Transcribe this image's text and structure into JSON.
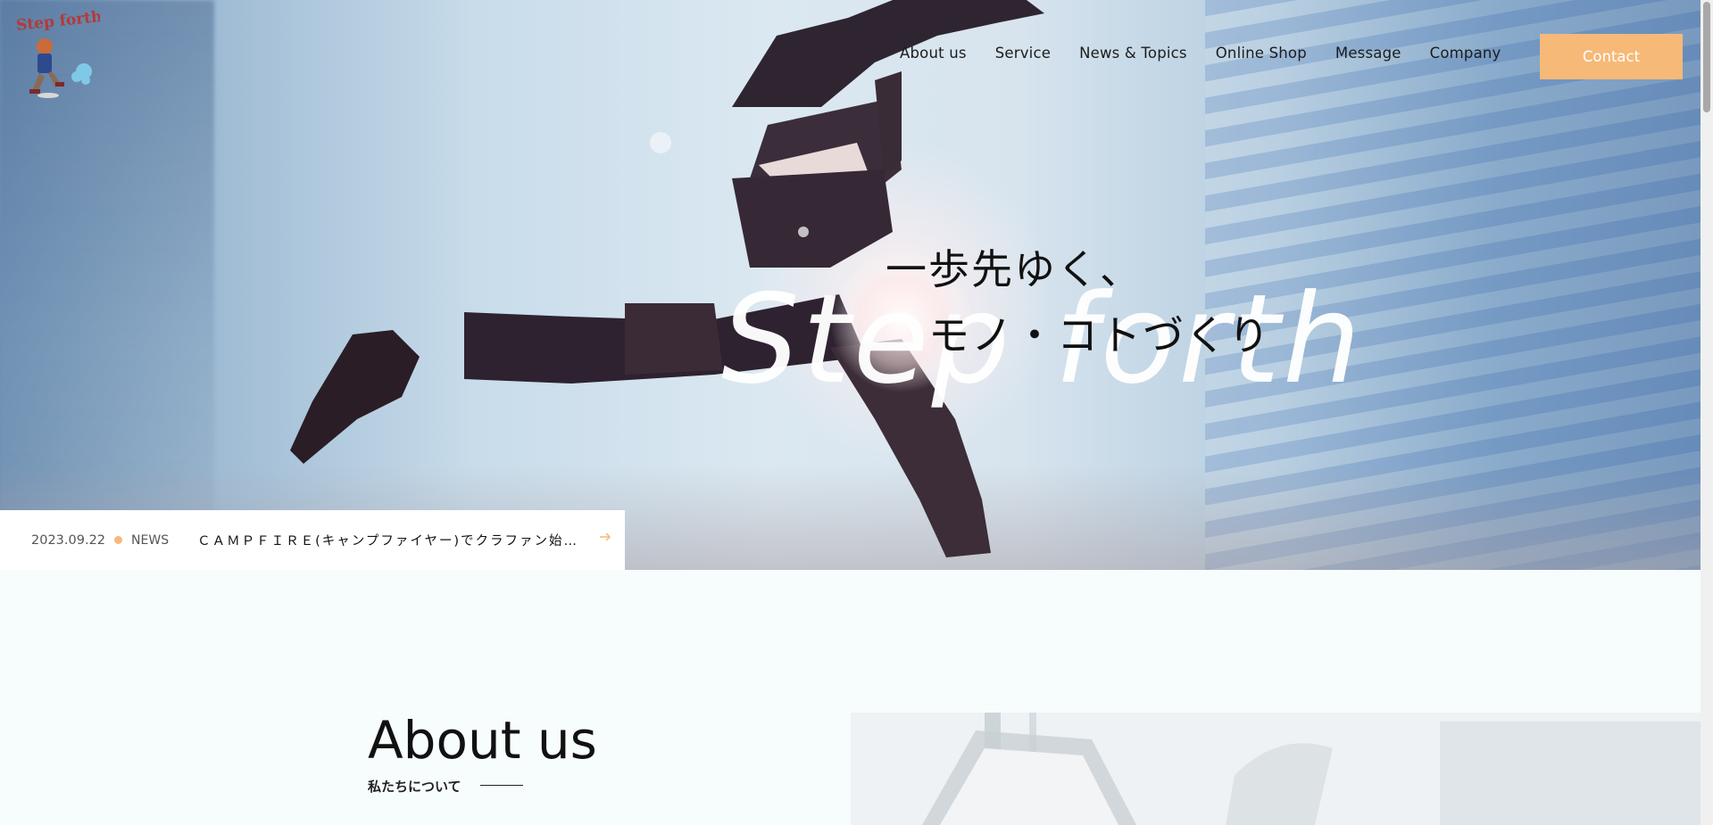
{
  "header": {
    "logo_alt": "Step forth",
    "nav": [
      "About us",
      "Service",
      "News & Topics",
      "Online Shop",
      "Message",
      "Company"
    ],
    "contact_label": "Contact"
  },
  "hero": {
    "jp_line1": "一歩先ゆく、",
    "jp_line2": "モノ・コトづくり",
    "en_title": "Step forth"
  },
  "news": {
    "date": "2023.09.22",
    "category": "NEWS",
    "title": "ＣＡＭＰＦＩＲＥ(キャンプファイヤー)でクラファン始めま..."
  },
  "about": {
    "title": "About us",
    "subtitle": "私たちについて"
  },
  "colors": {
    "accent": "#f6b978",
    "text": "#111111",
    "background": "#f7fcfd"
  }
}
